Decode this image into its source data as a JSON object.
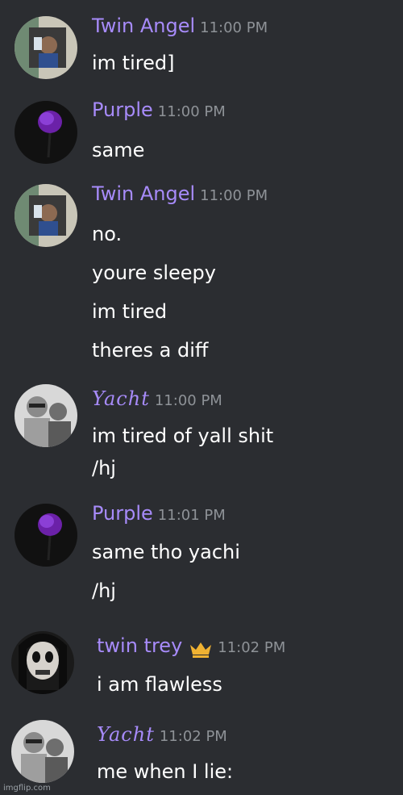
{
  "colors": {
    "background": "#2b2d31",
    "username": "#a78bfa",
    "timestamp": "#8e9297",
    "text": "#ffffff",
    "crown": "#f0b232"
  },
  "messages": [
    {
      "username": "Twin Angel",
      "timestamp": "11:00 PM",
      "lines": [
        "im tired]"
      ]
    },
    {
      "username": "Purple",
      "timestamp": "11:00 PM",
      "lines": [
        "same"
      ]
    },
    {
      "username": "Twin Angel",
      "timestamp": "11:00 PM",
      "lines": [
        "no.",
        "youre sleepy",
        "im tired",
        "theres a diff"
      ]
    },
    {
      "username": "Yacht",
      "timestamp": "11:00 PM",
      "lines": [
        "im tired of yall shit",
        "/hj"
      ]
    },
    {
      "username": "Purple",
      "timestamp": "11:01 PM",
      "lines": [
        "same tho yachi",
        "/hj"
      ]
    },
    {
      "username": "twin trey",
      "timestamp": "11:02 PM",
      "badge": "crown-icon",
      "lines": [
        "i am flawless"
      ]
    },
    {
      "username": "Yacht",
      "timestamp": "11:02 PM",
      "lines": [
        "me when I lie:"
      ]
    }
  ],
  "watermark": "imgflip.com"
}
